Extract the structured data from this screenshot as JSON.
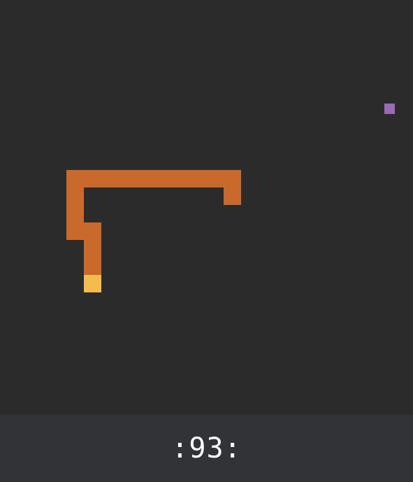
{
  "game": {
    "type": "snake",
    "score_display": ":93:"
  },
  "colors": {
    "background": "#2b2b2b",
    "score_bar": "#323337",
    "snake_body": "#c96a2c",
    "snake_head": "#f4bb4f",
    "food": "#9a6ab4",
    "score_text": "#ffffff"
  },
  "snake": {
    "length": 17,
    "head_direction": "down"
  },
  "food": {
    "icon": "food-pellet"
  }
}
